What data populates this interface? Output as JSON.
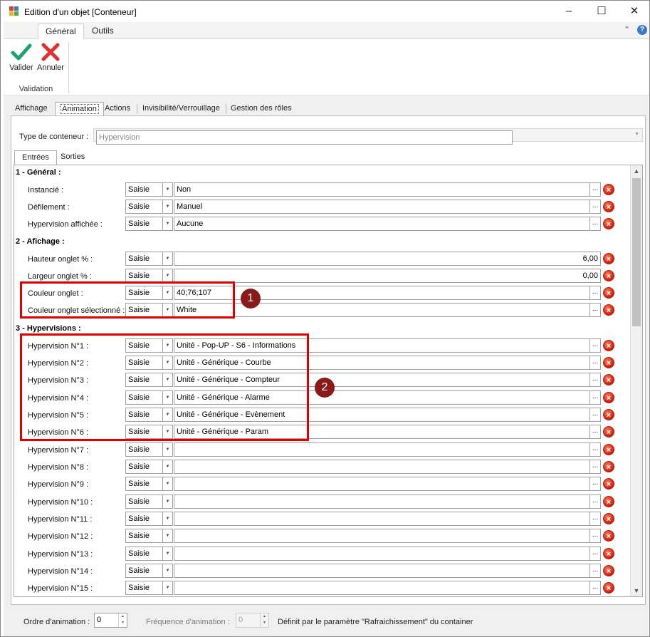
{
  "window": {
    "title": "Edition d'un objet [Conteneur]"
  },
  "ribbon": {
    "tabs": [
      "Général",
      "Outils"
    ],
    "buttons": {
      "validate": "Valider",
      "cancel": "Annuler"
    },
    "group_label": "Validation"
  },
  "main_tabs": [
    "Affichage",
    "Animation",
    "Actions",
    "Invisibilité/Verrouillage",
    "Gestion des rôles"
  ],
  "container_type": {
    "label": "Type de conteneur :",
    "value": "Hypervision"
  },
  "io_tabs": [
    "Entrées",
    "Sorties"
  ],
  "sections": {
    "general": "1 - Général :",
    "affichage": "2 - Afichage :",
    "hypervisions": "3 - Hypervisions :"
  },
  "rows": [
    {
      "label": "Instancié :",
      "mode": "Saisie",
      "value": "Non"
    },
    {
      "label": "Défilement :",
      "mode": "Saisie",
      "value": "Manuel"
    },
    {
      "label": "Hypervision affichée :",
      "mode": "Saisie",
      "value": "Aucune"
    },
    {
      "label": "Hauteur onglet % :",
      "mode": "Saisie",
      "value": "6,00"
    },
    {
      "label": "Largeur onglet % :",
      "mode": "Saisie",
      "value": "0,00"
    },
    {
      "label": "Couleur onglet :",
      "mode": "Saisie",
      "value": "40;76;107"
    },
    {
      "label": "Couleur onglet sélectionné :",
      "mode": "Saisie",
      "value": "White"
    },
    {
      "label": "Hypervision N°1 :",
      "mode": "Saisie",
      "value": "Unité - Pop-UP - S6 - Informations"
    },
    {
      "label": "Hypervision N°2 :",
      "mode": "Saisie",
      "value": "Unité - Générique - Courbe"
    },
    {
      "label": "Hypervision N°3 :",
      "mode": "Saisie",
      "value": "Unité - Générique - Compteur"
    },
    {
      "label": "Hypervision N°4 :",
      "mode": "Saisie",
      "value": "Unité - Générique - Alarme"
    },
    {
      "label": "Hypervision N°5 :",
      "mode": "Saisie",
      "value": "Unité - Générique - Evènement"
    },
    {
      "label": "Hypervision N°6 :",
      "mode": "Saisie",
      "value": "Unité - Générique - Param"
    },
    {
      "label": "Hypervision N°7 :",
      "mode": "Saisie",
      "value": ""
    },
    {
      "label": "Hypervision N°8 :",
      "mode": "Saisie",
      "value": ""
    },
    {
      "label": "Hypervision N°9 :",
      "mode": "Saisie",
      "value": ""
    },
    {
      "label": "Hypervision N°10 :",
      "mode": "Saisie",
      "value": ""
    },
    {
      "label": "Hypervision N°11 :",
      "mode": "Saisie",
      "value": ""
    },
    {
      "label": "Hypervision N°12 :",
      "mode": "Saisie",
      "value": ""
    },
    {
      "label": "Hypervision N°13 :",
      "mode": "Saisie",
      "value": ""
    },
    {
      "label": "Hypervision N°14 :",
      "mode": "Saisie",
      "value": ""
    },
    {
      "label": "Hypervision N°15 :",
      "mode": "Saisie",
      "value": ""
    }
  ],
  "markers": [
    "1",
    "2"
  ],
  "bottom": {
    "order_label": "Ordre d'animation :",
    "order_value": "0",
    "freq_label": "Fréquence d'animation :",
    "freq_value": "0",
    "freq_note": "Définit par le paramètre \"Rafraichissement\" du container"
  },
  "colors": {
    "highlight": "#e00000",
    "marker": "#8a1a1a",
    "validate": "#1aa36b",
    "cancel": "#e03030"
  }
}
